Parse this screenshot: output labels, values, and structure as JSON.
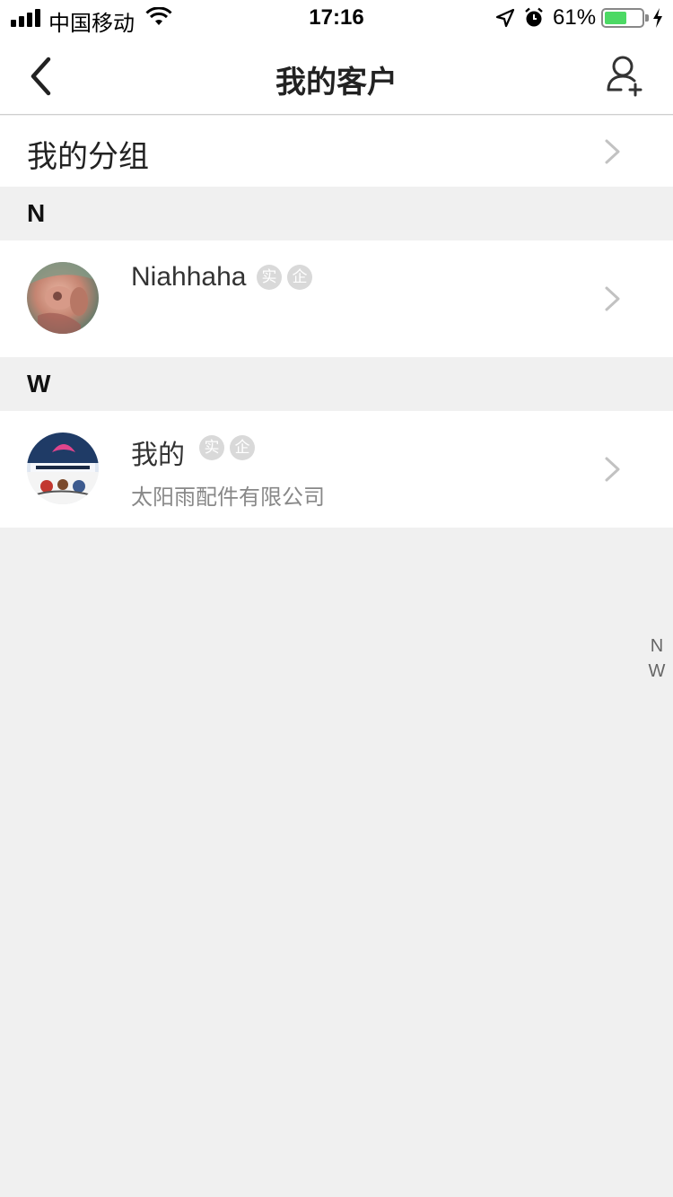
{
  "status_bar": {
    "carrier": "中国移动",
    "time": "17:16",
    "battery_percent": "61%",
    "battery_level": 0.61
  },
  "nav": {
    "title": "我的客户",
    "back_icon": "chevron-left-icon",
    "add_icon": "add-user-icon"
  },
  "groups_row": {
    "label": "我的分组"
  },
  "sections": [
    {
      "letter": "N",
      "customers": [
        {
          "name": "Niahhaha",
          "badges": [
            "实",
            "企"
          ],
          "company": ""
        }
      ]
    },
    {
      "letter": "W",
      "customers": [
        {
          "name": "我的",
          "badges": [
            "实",
            "企"
          ],
          "company": "太阳雨配件有限公司"
        }
      ]
    }
  ],
  "index_bar": [
    "N",
    "W"
  ],
  "colors": {
    "background": "#f0f0f0",
    "badge": "#d9d9d9",
    "battery": "#4cd964"
  }
}
